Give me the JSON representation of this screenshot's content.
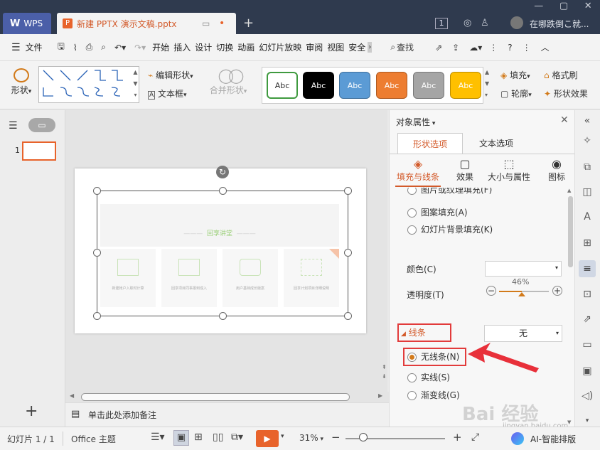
{
  "titlebar": {
    "wps_label": "WPS",
    "doc_tab": "新建 PPTX 演示文稿.pptx",
    "badge": "1",
    "account": "在哪跌倒こ就..."
  },
  "menu": {
    "file": "文件",
    "items": [
      "开始",
      "插入",
      "设计",
      "切换",
      "动画",
      "幻灯片放映",
      "审阅",
      "视图",
      "安全"
    ],
    "search": "查找"
  },
  "ribbon": {
    "shape": "形状",
    "edit_shape": "编辑形状",
    "textbox": "文本框",
    "merge_shape": "合并形状",
    "styles": [
      "Abc",
      "Abc",
      "Abc",
      "Abc",
      "Abc",
      "Abc"
    ],
    "fill": "填充",
    "format_brush": "格式刷",
    "outline": "轮廓",
    "shape_effect": "形状效果"
  },
  "slides": {
    "number": "1"
  },
  "slide": {
    "heading": "回享讲堂",
    "cards": [
      "新建帐户入职时计算",
      "回享项目同事报到成入",
      "用户基础成长版案",
      "回享计划项目详细说明"
    ]
  },
  "notes": {
    "placeholder": "单击此处添加备注"
  },
  "panel": {
    "title": "对象属性",
    "tabs": {
      "shape": "形状选项",
      "text": "文本选项"
    },
    "subtabs": [
      "填充与线条",
      "效果",
      "大小与属性",
      "图标"
    ],
    "fill_options": [
      "图片或纹理填充(F)",
      "图案填充(A)",
      "幻灯片背景填充(K)"
    ],
    "color_label": "颜色(C)",
    "transparency_label": "透明度(T)",
    "transparency_value": "46%",
    "transparency": 0.46,
    "line_section": "线条",
    "line_select": "无",
    "line_options": [
      "无线条(N)",
      "实线(S)",
      "渐变线(G)"
    ]
  },
  "status": {
    "slide_info": "幻灯片 1 / 1",
    "theme": "Office 主题",
    "zoom": "31%",
    "zoom_value": 0.31,
    "ai": "AI-智能排版"
  },
  "watermark": {
    "brand": "Bai 经验",
    "url": "jingyan.baidu.com"
  },
  "colors": {
    "accent": "#e8632b",
    "dark": "#2f3a4e",
    "highlight_box": "#e23b3b",
    "radio_on": "#d27a1a"
  }
}
